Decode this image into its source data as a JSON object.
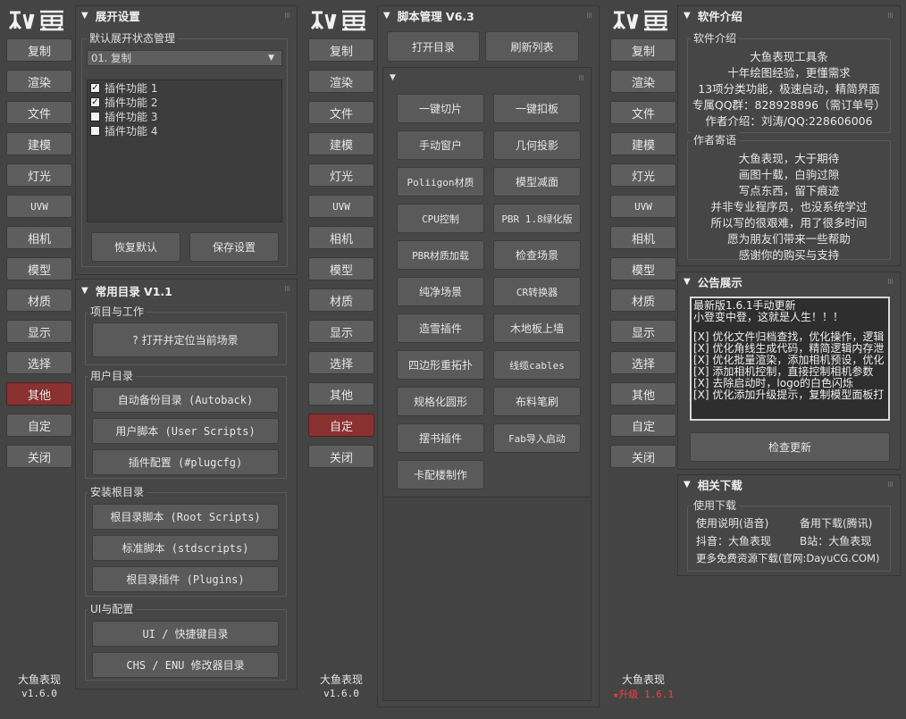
{
  "sidebar": {
    "logo_text": "水鱼",
    "items": [
      "复制",
      "渲染",
      "文件",
      "建模",
      "灯光",
      "UVW",
      "相机",
      "模型",
      "材质",
      "显示",
      "选择",
      "其他",
      "自定",
      "关闭"
    ],
    "footer_name": "大鱼表现",
    "footer_version": "v1.6.0",
    "upgrade_text": "升级 1.6.1",
    "star_icon": "★"
  },
  "expand_settings": {
    "title": "展开设置",
    "group_label": "默认展开状态管理",
    "selected": "01. 复制",
    "items": [
      {
        "label": "插件功能 1",
        "checked": true
      },
      {
        "label": "插件功能 2",
        "checked": true
      },
      {
        "label": "插件功能 3",
        "checked": false
      },
      {
        "label": "插件功能 4",
        "checked": false
      }
    ],
    "restore_label": "恢复默认",
    "save_label": "保存设置"
  },
  "common_dirs": {
    "title": "常用目录 V1.1",
    "project_label": "项目与工作",
    "open_scene": "? 打开并定位当前场景",
    "user_label": "用户目录",
    "autoback": "自动备份目录 (Autoback)",
    "user_scripts": "用户脚本 (User Scripts)",
    "plugcfg": "插件配置 (#plugcfg)",
    "install_label": "安装根目录",
    "root_scripts": "根目录脚本 (Root Scripts)",
    "stdscripts": "标准脚本 (stdscripts)",
    "plugins": "根目录插件 (Plugins)",
    "ui_label": "UI与配置",
    "ui_hotkeys": "UI / 快捷键目录",
    "chs_enu": "CHS / ENU 修改器目录"
  },
  "script_mgr": {
    "title": "脚本管理 V6.3",
    "open_dir": "打开目录",
    "refresh": "刷新列表",
    "buttons": [
      "一键切片",
      "一键扣板",
      "手动窗户",
      "几何投影",
      "Poliigon材质",
      "模型减面",
      "CPU控制",
      "PBR 1.8绿化版",
      "PBR材质加载",
      "检查场景",
      "纯净场景",
      "CR转换器",
      "造雪插件",
      "木地板上墙",
      "四边形重拓扑",
      "线缆cables",
      "规格化圆形",
      "布料笔刷",
      "摆书插件",
      "Fab导入启动",
      "卡配楼制作"
    ]
  },
  "intro": {
    "title": "软件介绍",
    "group_label": "软件介绍",
    "lines": [
      "大鱼表现工具条",
      "十年绘图经验，更懂需求",
      "13项分类功能，极速启动，精简界面",
      "专属QQ群：828928896（需订单号）",
      "作者介绍：刘涛/QQ:228606006"
    ],
    "msg_label": "作者寄语",
    "msg_lines": [
      "大鱼表现，大于期待",
      "画图十载，白驹过隙",
      "写点东西，留下痕迹",
      "并非专业程序员，也没系统学过",
      "所以写的很艰难，用了很多时间",
      "愿为朋友们带来一些帮助",
      "感谢你的购买与支持"
    ]
  },
  "notice": {
    "title": "公告展示",
    "lines": [
      "最新版1.6.1手动更新",
      "小登变中登，这就是人生！！！",
      "",
      "[X] 优化文件归档查找，优化操作，逻辑",
      "[X] 优化角线生成代码，精简逻辑内存泄",
      "[X] 优化批量渲染，添加相机预设，优化",
      "[X] 添加相机控制，直接控制相机参数",
      "[X] 去除启动时，logo的白色闪烁",
      "[X] 优化添加升级提示，复制模型面板打"
    ],
    "check_update": "检查更新"
  },
  "downloads": {
    "title": "相关下载",
    "group_label": "使用下载",
    "manual": "使用说明(语音)",
    "backup": "备用下载(腾讯)",
    "douyin": "抖音：大鱼表现",
    "bilibili": "B站：大鱼表现",
    "more": "更多免费资源下载(官网:DayuCG.COM)"
  }
}
